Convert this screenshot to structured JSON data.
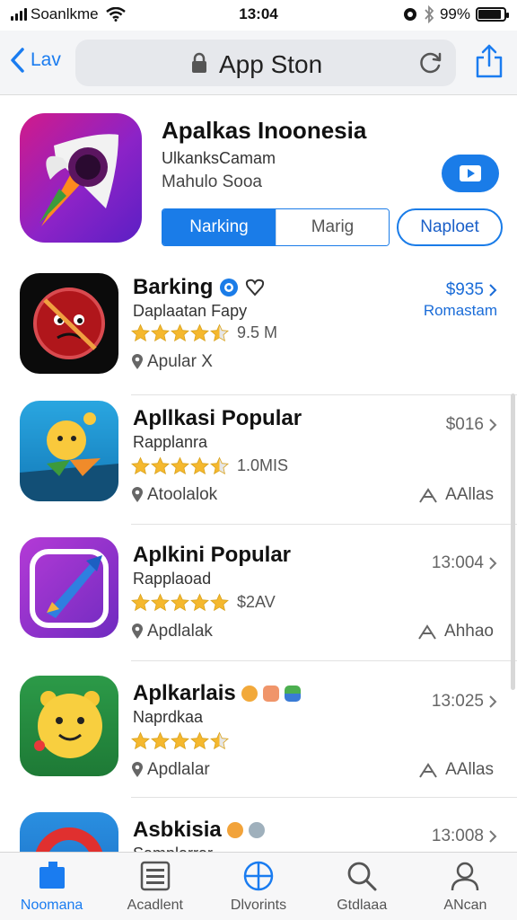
{
  "status_bar": {
    "carrier": "Soanlkme",
    "time": "13:04",
    "battery": "99%",
    "battery_level": 0.9
  },
  "nav": {
    "back_label": "Lav",
    "address_title": "App Ston"
  },
  "featured": {
    "title": "Apalkas Inoonesia",
    "subtitle_1": "UlkanksCamam",
    "subtitle_2": "Mahulo Sooa",
    "segment_selected": "Narking",
    "segment_other": "Marig",
    "action_button": "Naploet",
    "colors": {
      "accent": "#1a7ce8"
    }
  },
  "apps": [
    {
      "title": "Barking",
      "subtitle": "Daplaatan Fapy",
      "rating": 4.5,
      "rating_text": "9.5 M",
      "location": "Apular X",
      "price": "$935",
      "price_sub": "Romastam",
      "icon_name": "forbidden-face-icon"
    },
    {
      "title": "Apllkasi Popular",
      "subtitle": "Rapplanra",
      "rating": 4.5,
      "rating_text": "1.0MIS",
      "location": "Atoolalok",
      "price": "$016",
      "right_label": "AAllas",
      "icon_name": "cartoon-character-icon"
    },
    {
      "title": "Aplkini Popular",
      "subtitle": "Rapplaoad",
      "rating": 5,
      "rating_text": "$2AV",
      "location": "Apdlalak",
      "price": "13:004",
      "right_label": "Ahhao",
      "icon_name": "rocket-icon"
    },
    {
      "title": "Aplkarlais",
      "subtitle": "Naprdkaa",
      "rating": 4.5,
      "rating_text": "",
      "location": "Apdlalar",
      "price": "13:025",
      "right_label": "AAllas",
      "icon_name": "smiley-character-icon"
    },
    {
      "title": "Asbkisia",
      "subtitle": "Samplarrar",
      "price": "13:008",
      "icon_name": "red-ring-icon"
    }
  ],
  "tabs": [
    {
      "label": "Noomana",
      "icon": "home-icon",
      "active": true
    },
    {
      "label": "Acadlent",
      "icon": "list-icon",
      "active": false
    },
    {
      "label": "Dlvorints",
      "icon": "compass-icon",
      "active": false
    },
    {
      "label": "Gtdlaaa",
      "icon": "search-icon",
      "active": false
    },
    {
      "label": "ANcan",
      "icon": "account-icon",
      "active": false
    }
  ]
}
